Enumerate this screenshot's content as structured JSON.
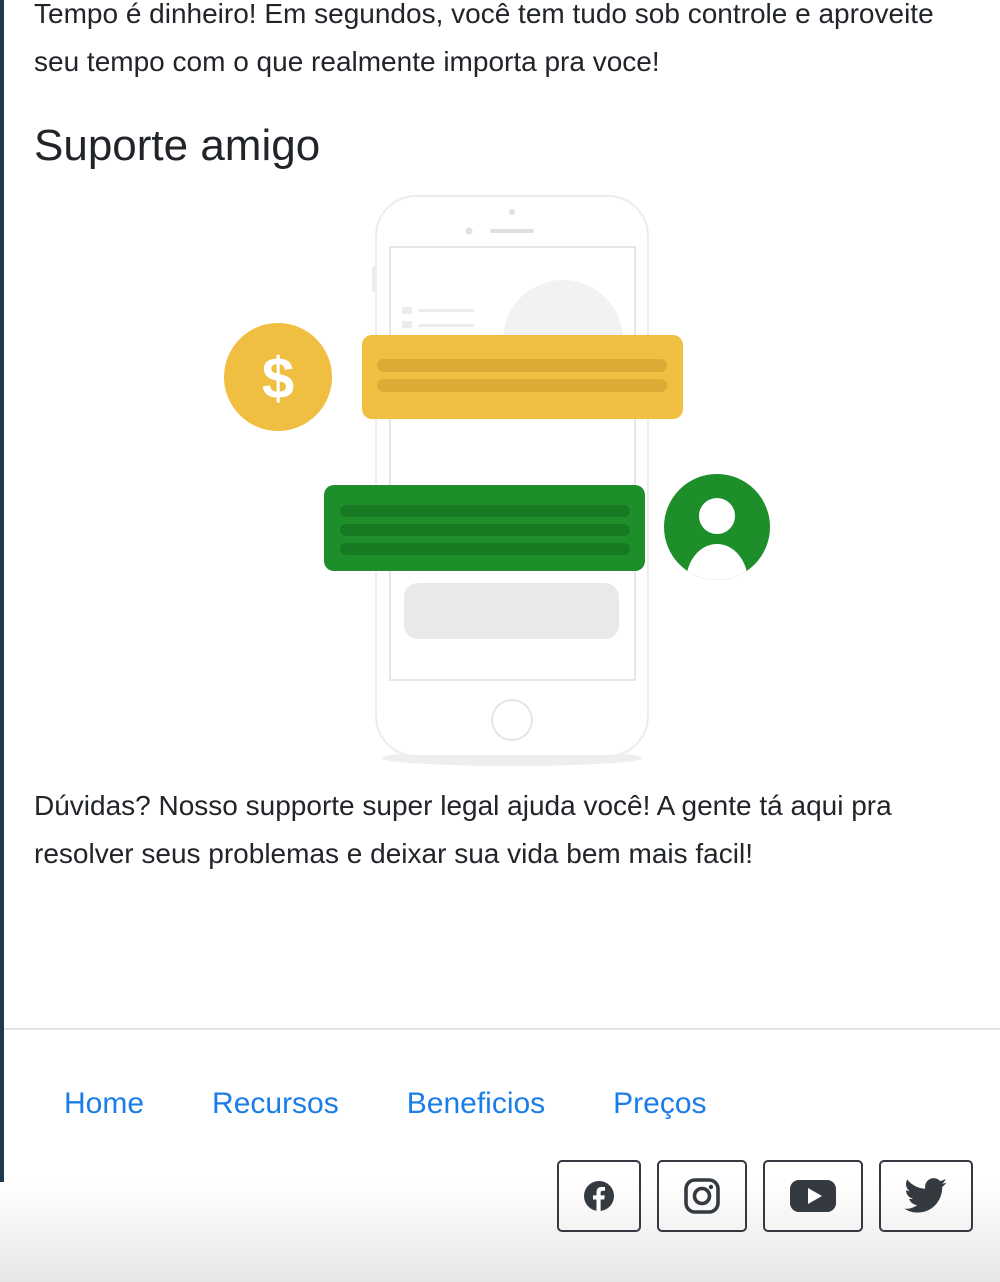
{
  "intro": {
    "text": "Tempo é dinheiro! Em segundos, você tem tudo sob controle e aproveite seu tempo com o que realmente importa pra voce!"
  },
  "support": {
    "title": "Suporte amigo",
    "text": "Dúvidas? Nosso supporte super legal ajuda você! A gente tá aqui pra resolver seus problemas e deixar sua vida bem mais facil!",
    "illustration": {
      "coin_symbol": "$",
      "colors": {
        "yellow": "#f0be41",
        "green": "#1e8e2b",
        "phone_border": "#e8e8e8"
      }
    }
  },
  "footer": {
    "nav": [
      {
        "label": "Home"
      },
      {
        "label": "Recursos"
      },
      {
        "label": "Beneficios"
      },
      {
        "label": "Preços"
      }
    ],
    "social": [
      {
        "icon": "facebook-icon"
      },
      {
        "icon": "instagram-icon"
      },
      {
        "icon": "youtube-icon"
      },
      {
        "icon": "twitter-icon"
      }
    ],
    "link_color": "#1a7de8"
  }
}
